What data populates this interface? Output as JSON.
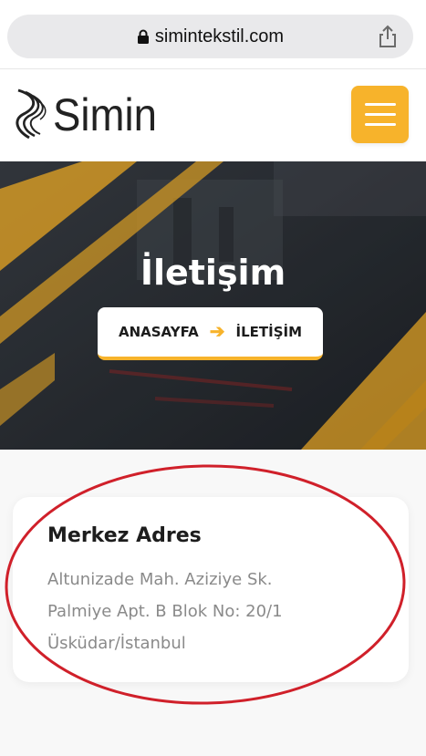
{
  "browser": {
    "url": "simintekstil.com",
    "icons": [
      "lock-icon",
      "share-icon"
    ]
  },
  "header": {
    "logo_text": "SIMIN",
    "menu_icon": "hamburger-menu-icon"
  },
  "hero": {
    "title": "İletişim",
    "breadcrumb": [
      {
        "label": "ANASAYFA"
      },
      {
        "label": "İLETİŞİM"
      }
    ],
    "breadcrumb_separator_icon": "arrow-right-icon"
  },
  "contact": {
    "title": "Merkez Adres",
    "address_lines": [
      "Altunizade Mah. Aziziye Sk.",
      "Palmiye Apt. B Blok No: 20/1",
      "Üsküdar/İstanbul"
    ]
  },
  "colors": {
    "accent": "#f7b32b",
    "annotation": "#d0202a",
    "hero_dark": "#2b3037"
  }
}
